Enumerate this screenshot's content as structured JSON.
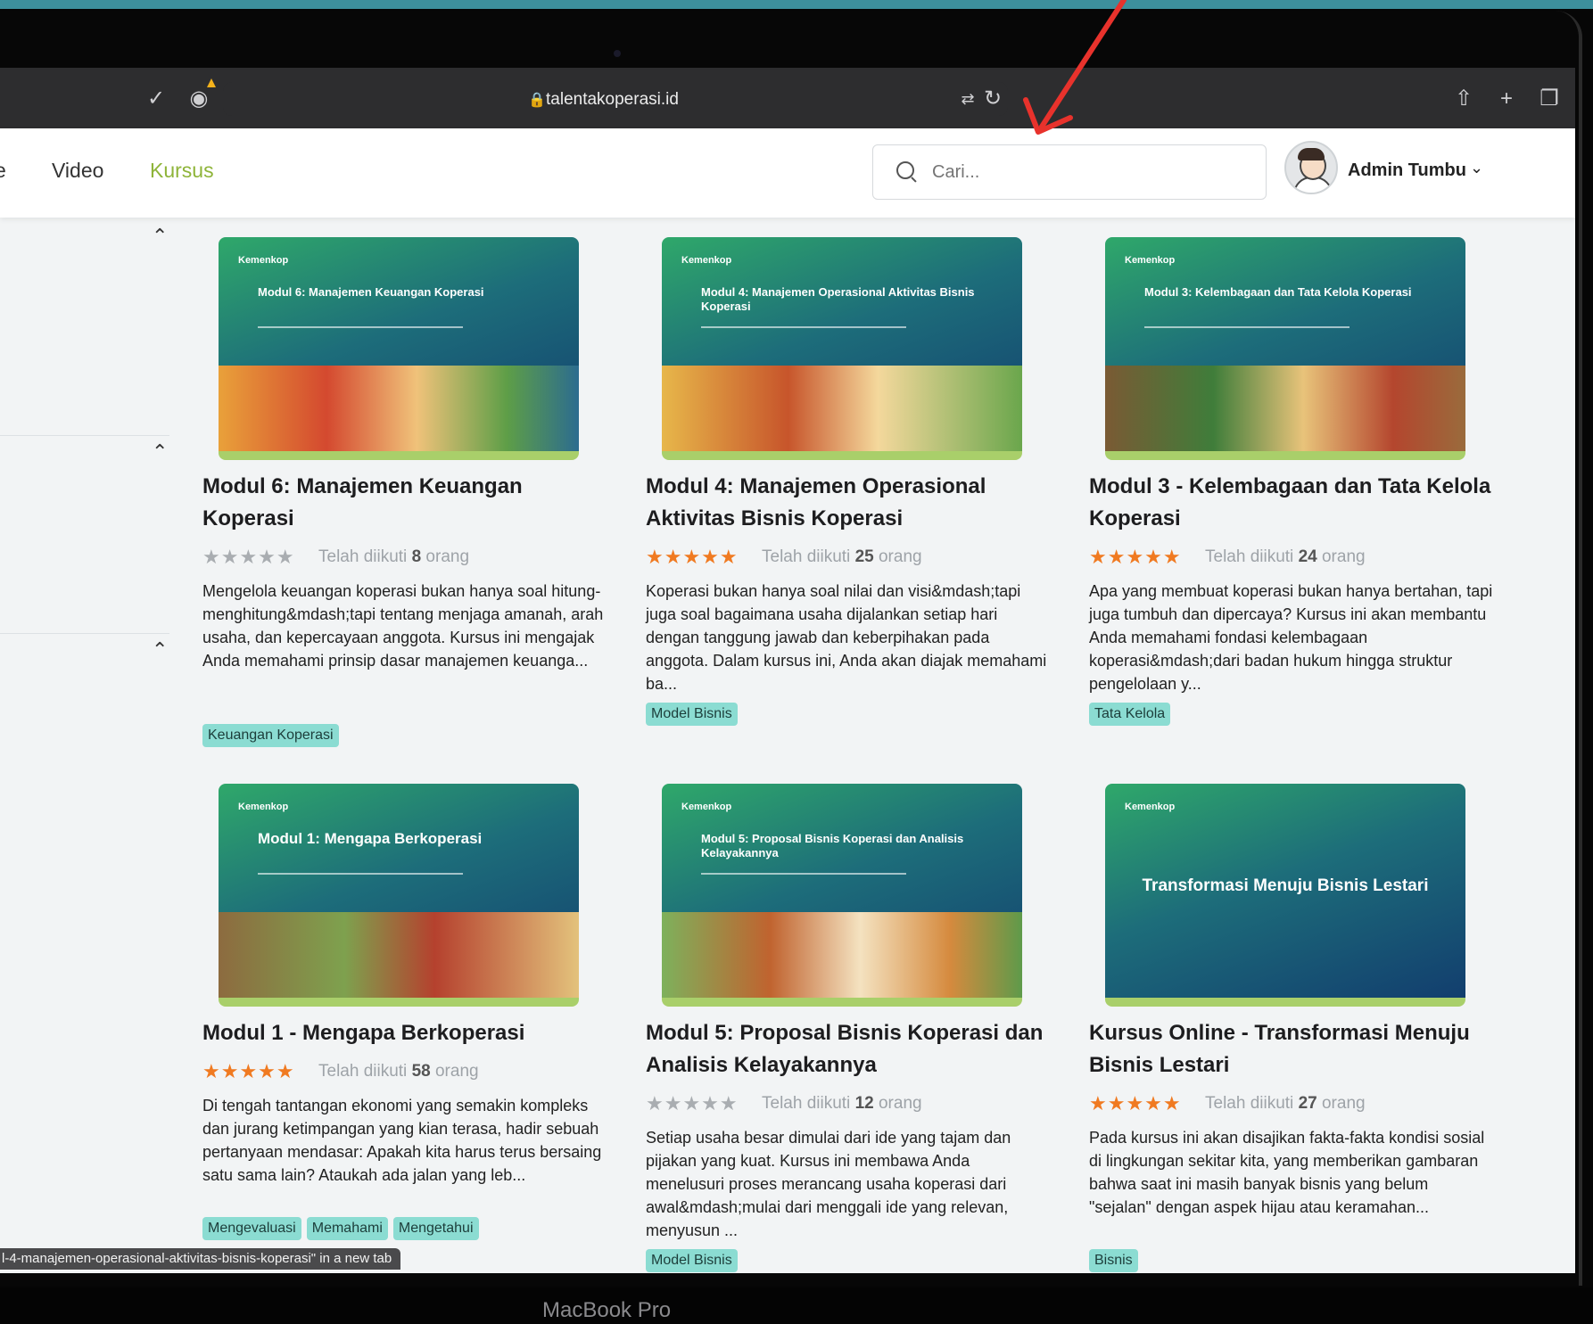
{
  "browser": {
    "url": "talentakoperasi.id",
    "status_text": "l-4-manajemen-operasional-aktivitas-bisnis-koperasi\" in a new tab"
  },
  "nav": {
    "cut_item": "e",
    "video": "Video",
    "kursus": "Kursus"
  },
  "search": {
    "placeholder": "Cari..."
  },
  "user": {
    "name": "Admin Tumbu"
  },
  "brand_label": "Kemenkop",
  "courses": [
    {
      "thumb_title": "Modul 6: Manajemen Keuangan Koperasi",
      "title": "Modul 6: Manajemen Keuangan Koperasi",
      "rating": 0,
      "enrolled_prefix": "Telah diikuti",
      "enrolled_count": "8",
      "enrolled_suffix": "orang",
      "description": "Mengelola keuangan koperasi bukan hanya soal hitung-menghitung&mdash;tapi tentang menjaga amanah, arah usaha, dan kepercayaan anggota. Kursus ini mengajak Anda memahami prinsip dasar manajemen keuanga...",
      "tags": [
        "Keuangan Koperasi"
      ]
    },
    {
      "thumb_title": "Modul 4: Manajemen Operasional Aktivitas Bisnis Koperasi",
      "title": "Modul 4: Manajemen Operasional Aktivitas Bisnis Koperasi",
      "rating": 5,
      "enrolled_prefix": "Telah diikuti",
      "enrolled_count": "25",
      "enrolled_suffix": "orang",
      "description": "Koperasi bukan hanya soal nilai dan visi&mdash;tapi juga soal bagaimana usaha dijalankan setiap hari dengan tanggung jawab dan keberpihakan pada anggota. Dalam kursus ini, Anda akan diajak memahami ba...",
      "tags": [
        "Model Bisnis"
      ]
    },
    {
      "thumb_title": "Modul 3: Kelembagaan dan Tata Kelola Koperasi",
      "title": "Modul 3 - Kelembagaan dan Tata Kelola Koperasi",
      "rating": 5,
      "enrolled_prefix": "Telah diikuti",
      "enrolled_count": "24",
      "enrolled_suffix": "orang",
      "description": "Apa yang membuat koperasi bukan hanya bertahan, tapi juga tumbuh dan dipercaya? Kursus ini akan membantu Anda memahami fondasi kelembagaan koperasi&mdash;dari badan hukum hingga struktur pengelolaan y...",
      "tags": [
        "Tata Kelola"
      ]
    },
    {
      "thumb_title": "Modul 1: Mengapa Berkoperasi",
      "title": "Modul 1 - Mengapa Berkoperasi",
      "rating": 5,
      "enrolled_prefix": "Telah diikuti",
      "enrolled_count": "58",
      "enrolled_suffix": "orang",
      "description": "Di tengah tantangan ekonomi yang semakin kompleks dan jurang ketimpangan yang kian terasa, hadir sebuah pertanyaan mendasar: Apakah kita harus terus bersaing satu sama lain? Ataukah ada jalan yang leb...",
      "tags": [
        "Mengevaluasi",
        "Memahami",
        "Mengetahui"
      ]
    },
    {
      "thumb_title": "Modul 5: Proposal Bisnis Koperasi dan Analisis Kelayakannya",
      "title": "Modul 5: Proposal Bisnis Koperasi dan Analisis Kelayakannya",
      "rating": 0,
      "enrolled_prefix": "Telah diikuti",
      "enrolled_count": "12",
      "enrolled_suffix": "orang",
      "description": "Setiap usaha besar dimulai dari ide yang tajam dan pijakan yang kuat. Kursus ini membawa Anda menelusuri proses merancang usaha koperasi dari awal&mdash;mulai dari menggali ide yang relevan, menyusun ...",
      "tags": [
        "Model Bisnis"
      ]
    },
    {
      "thumb_title": "Transformasi Menuju Bisnis Lestari",
      "title": "Kursus Online - Transformasi Menuju Bisnis Lestari",
      "rating": 5,
      "enrolled_prefix": "Telah diikuti",
      "enrolled_count": "27",
      "enrolled_suffix": "orang",
      "description": "Pada kursus ini akan disajikan fakta-fakta kondisi sosial di lingkungan sekitar kita, yang memberikan gambaran bahwa saat ini masih banyak bisnis yang belum \"sejalan\" dengan aspek hijau atau keramahan...",
      "tags": [
        "Bisnis"
      ]
    }
  ],
  "device_label": "MacBook Pro",
  "colors": {
    "accent": "#8eb439",
    "star": "#f07a21",
    "tag": "#8bdcd2"
  }
}
